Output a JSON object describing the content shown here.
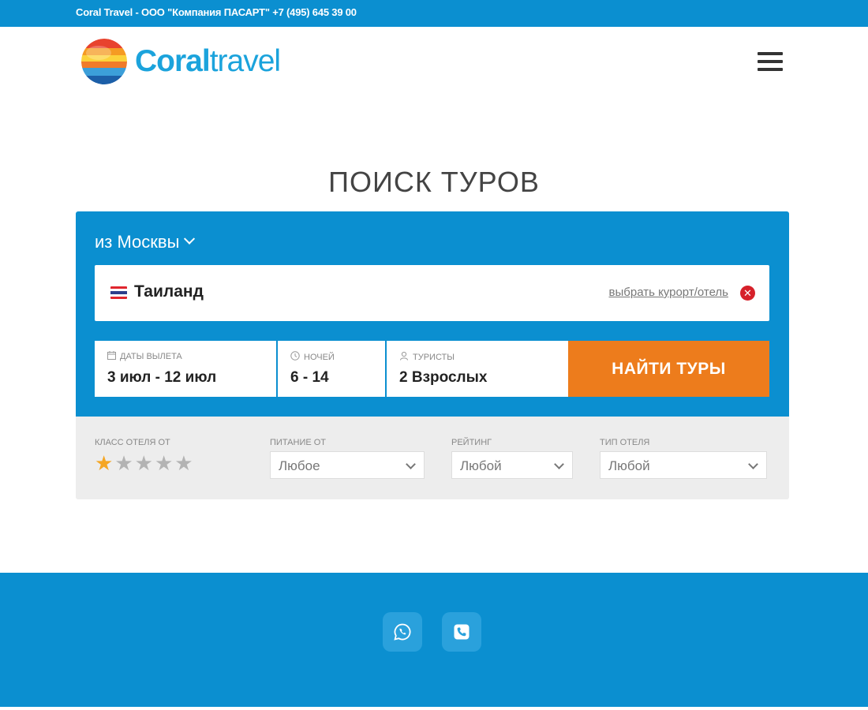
{
  "topbar": {
    "text": "Coral Travel - ООО \"Компания ПАСАРТ\" +7 (495) 645 39 00"
  },
  "header": {
    "logo_bold": "Coral",
    "logo_light": "travel",
    "menu_icon": "hamburger-menu-icon"
  },
  "page": {
    "title": "ПОИСК ТУРОВ"
  },
  "search": {
    "from_city": "из Москвы",
    "destination": "Таиланд",
    "resort_link": "выбрать курорт/отель",
    "clear_icon": "close-icon",
    "dates_label": "Даты вылета",
    "dates_value": "3 июл - 12 июл",
    "nights_label": "Ночей",
    "nights_value": "6 - 14",
    "tourists_label": "Туристы",
    "tourists_value": "2 Взрослых",
    "submit_label": "НАЙТИ ТУРЫ"
  },
  "filters": {
    "hotel_class_label": "Класс отеля от",
    "hotel_class_selected": 1,
    "hotel_class_max": 5,
    "meal_label": "Питание от",
    "meal_value": "Любое",
    "rating_label": "Рейтинг",
    "rating_value": "Любой",
    "hotel_type_label": "Тип отеля",
    "hotel_type_value": "Любой"
  },
  "footer": {
    "icons": [
      "whatsapp-icon",
      "phone-icon"
    ]
  },
  "colors": {
    "brand_blue": "#0b8fd0",
    "accent_orange": "#ed7c1c",
    "star_active": "#f5a623",
    "star_inactive": "#b3b3b3"
  }
}
